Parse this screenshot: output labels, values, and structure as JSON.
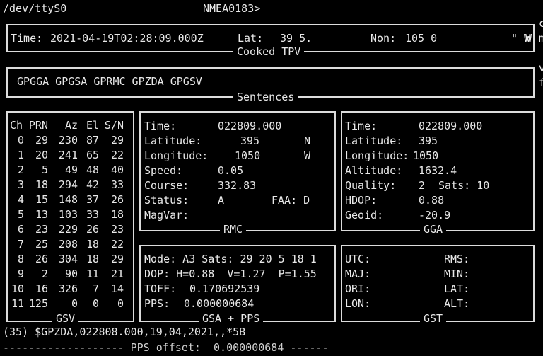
{
  "header": {
    "device": "/dev/ttyS0",
    "protocol": "NMEA0183>"
  },
  "right_margin": [
    "c",
    "m",
    "v",
    "f"
  ],
  "tpv": {
    "title": "Cooked TPV",
    "time_label": "Time:",
    "time_value": "2021-04-19T02:28:09.000Z",
    "lat_label": "Lat:",
    "lat_value": "39 5.",
    "lon_label": "Non:",
    "lon_value": "105 0",
    "lon_suffix": "\" W",
    "end_char": "W"
  },
  "sentences": {
    "title": "Sentences",
    "value": "GPGGA GPGSA GPRMC GPZDA GPGSV"
  },
  "gsv": {
    "title": "GSV",
    "headers": [
      "Ch",
      "PRN",
      "Az",
      "El",
      "S/N"
    ],
    "rows": [
      [
        "0",
        "29",
        "230",
        "87",
        "29"
      ],
      [
        "1",
        "20",
        "241",
        "65",
        "22"
      ],
      [
        "2",
        "5",
        "49",
        "48",
        "40"
      ],
      [
        "3",
        "18",
        "294",
        "42",
        "33"
      ],
      [
        "4",
        "15",
        "148",
        "37",
        "26"
      ],
      [
        "5",
        "13",
        "103",
        "33",
        "18"
      ],
      [
        "6",
        "23",
        "229",
        "26",
        "23"
      ],
      [
        "7",
        "25",
        "208",
        "18",
        "22"
      ],
      [
        "8",
        "26",
        "304",
        "18",
        "29"
      ],
      [
        "9",
        "2",
        "90",
        "11",
        "21"
      ],
      [
        "10",
        "16",
        "326",
        "7",
        "14"
      ],
      [
        "11",
        "125",
        "0",
        "0",
        "0"
      ]
    ]
  },
  "rmc": {
    "title": "RMC",
    "time_label": "Time:",
    "time_value": "022809.000",
    "lat_label": "Latitude:",
    "lat_value": "395",
    "lat_hemi": "N",
    "lon_label": "Longitude:",
    "lon_value": "1050",
    "lon_hemi": "W",
    "speed_label": "Speed:",
    "speed_value": "0.05",
    "course_label": "Course:",
    "course_value": "332.83",
    "status_label": "Status:",
    "status_value": "A",
    "faa_label": "FAA:",
    "faa_value": "D",
    "magvar_label": "MagVar:",
    "magvar_value": ""
  },
  "gga": {
    "title": "GGA",
    "time_label": "Time:",
    "time_value": "022809.000",
    "lat_label": "Latitude:",
    "lat_value": "395",
    "lon_label": "Longitude:",
    "lon_value": "1050",
    "alt_label": "Altitude:",
    "alt_value": "1632.4",
    "quality_label": "Quality:",
    "quality_value": "2",
    "sats_label": "Sats:",
    "sats_value": "10",
    "hdop_label": "HDOP:",
    "hdop_value": "0.88",
    "geoid_label": "Geoid:",
    "geoid_value": "-20.9"
  },
  "gsa": {
    "title": "GSA + PPS",
    "mode_line": "Mode: A3 Sats: 29 20 5 18 1",
    "dop_line": "DOP: H=0.88  V=1.27  P=1.55",
    "toff_label": "TOFF:",
    "toff_value": "0.170692539",
    "pps_label": "PPS:",
    "pps_value": "0.000000684"
  },
  "gst": {
    "title": "GST",
    "utc_label": "UTC:",
    "rms_label": "RMS:",
    "maj_label": "MAJ:",
    "min_label": "MIN:",
    "ori_label": "ORI:",
    "lat_label": "LAT:",
    "lon_label": "LON:",
    "alt_label": "ALT:"
  },
  "footer": {
    "raw_sentence": "(35) $GPZDA,022808.000,19,04,2021,,*5B",
    "pps_line": "------------------- PPS offset:  0.000000684 ------"
  }
}
